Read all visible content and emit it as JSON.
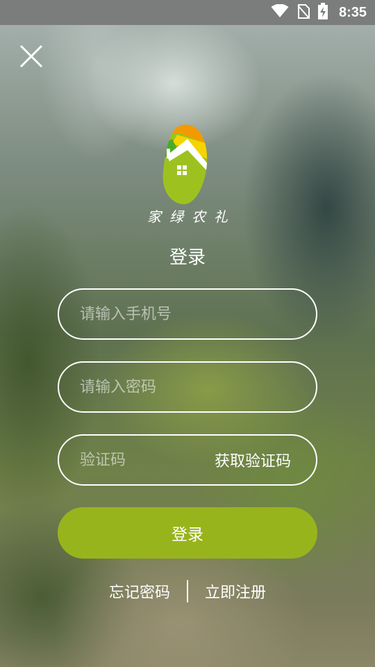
{
  "status_bar": {
    "time": "8:35",
    "icons": [
      "wifi-icon",
      "no-sim-icon",
      "battery-charging-icon"
    ]
  },
  "brand": {
    "name": "家绿农礼",
    "logo_colors": {
      "leaf": "#9dc21f",
      "stripe_orange": "#f39a00",
      "stripe_yellow": "#f5d400",
      "stripe_green": "#4caa2a"
    }
  },
  "login": {
    "title": "登录",
    "phone_placeholder": "请输入手机号",
    "password_placeholder": "请输入密码",
    "code_placeholder": "验证码",
    "get_code_label": "获取验证码",
    "submit_label": "登录",
    "forgot_password_label": "忘记密码",
    "register_label": "立即注册"
  },
  "colors": {
    "accent": "#98b41c",
    "text": "#ffffff"
  }
}
